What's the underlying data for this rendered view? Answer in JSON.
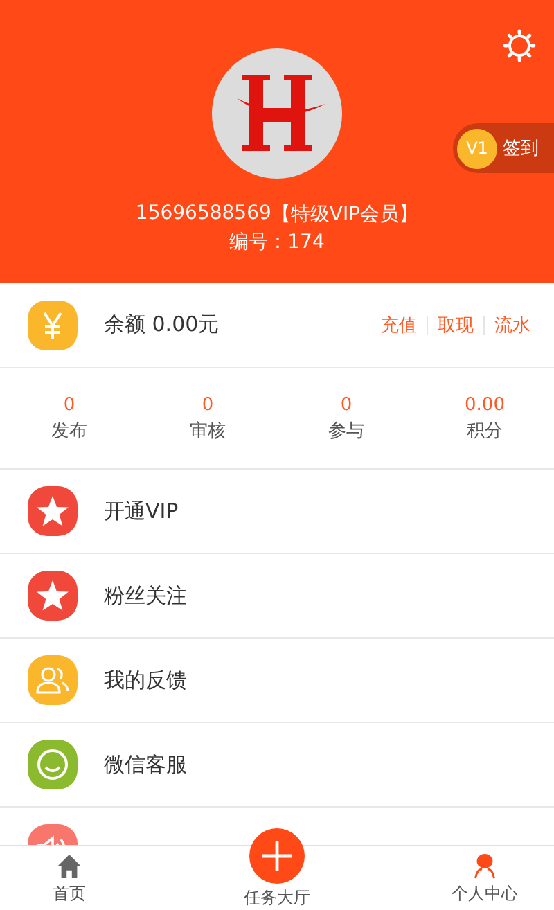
{
  "header": {
    "phone": "15696588569",
    "level_title": "【特级VIP会员】",
    "member_id": "编号：174",
    "checkin": {
      "level": "V1",
      "label": "签到"
    }
  },
  "balance": {
    "text": "余额 0.00元",
    "actions": [
      "充值",
      "取现",
      "流水"
    ]
  },
  "stats": [
    {
      "value": "0",
      "label": "发布"
    },
    {
      "value": "0",
      "label": "审核"
    },
    {
      "value": "0",
      "label": "参与"
    },
    {
      "value": "0.00",
      "label": "积分"
    }
  ],
  "menu": [
    {
      "kind": "star",
      "color": "#f0483b",
      "label": "开通VIP"
    },
    {
      "kind": "star",
      "color": "#f0483b",
      "label": "粉丝关注"
    },
    {
      "kind": "people",
      "color": "#fbb72b",
      "label": "我的反馈"
    },
    {
      "kind": "chat",
      "color": "#8cba2f",
      "label": "微信客服"
    },
    {
      "kind": "speaker",
      "color": "#f8766b"
    }
  ],
  "tab_bar": [
    {
      "kind": "home",
      "label": "首页",
      "selected": false
    },
    {
      "kind": "plus",
      "label": "任务大厅",
      "selected": false
    },
    {
      "kind": "person",
      "label": "个人中心",
      "selected": true
    }
  ]
}
